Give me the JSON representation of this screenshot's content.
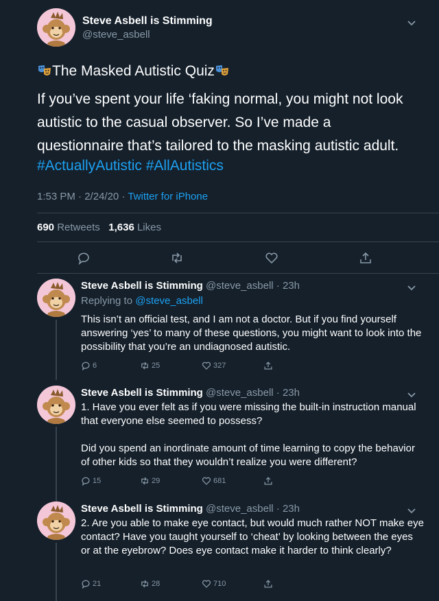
{
  "main_tweet": {
    "author_name": "Steve Asbell is Stimming",
    "author_handle": "@steve_asbell",
    "title": "The Masked Autistic Quiz",
    "body": "If you’ve spent your life ‘faking normal, you might not look autistic to the casual observer. So I’ve made a questionnaire that’s tailored to the masking autistic adult.",
    "hashtags": "#ActuallyAutistic #AllAutistics",
    "time": "1:53 PM",
    "date": "2/24/20",
    "separator": "·",
    "source": "Twitter for iPhone",
    "retweets_count": "690",
    "retweets_label": "Retweets",
    "likes_count": "1,636",
    "likes_label": "Likes"
  },
  "replies": [
    {
      "author_name": "Steve Asbell is Stimming",
      "handle_time": "@steve_asbell · 23h",
      "replying_prefix": "Replying to ",
      "replying_handle": "@steve_asbell",
      "paragraphs": [
        "This isn’t an official test, and I am not a doctor. But if you find yourself answering ‘yes’ to many of these questions, you might want to look into the possibility that you’re an undiagnosed autistic."
      ],
      "replies": "6",
      "retweets": "25",
      "likes": "327"
    },
    {
      "author_name": "Steve Asbell is Stimming",
      "handle_time": "@steve_asbell · 23h",
      "paragraphs": [
        "1. Have you ever felt as if you were missing the built-in instruction manual that everyone else seemed to possess?",
        "Did you spend an inordinate amount of time learning to copy the behavior of other kids so that they wouldn’t realize you were different?"
      ],
      "replies": "15",
      "retweets": "29",
      "likes": "681"
    },
    {
      "author_name": "Steve Asbell is Stimming",
      "handle_time": "@steve_asbell · 23h",
      "paragraphs": [
        "2. Are you able to make eye contact, but would much rather NOT make eye contact? Have you taught yourself to ‘cheat’ by looking between the eyes or at the eyebrow? Does eye contact make it harder to think clearly?"
      ],
      "replies": "21",
      "retweets": "28",
      "likes": "710"
    }
  ],
  "colors": {
    "background": "#15202b",
    "text": "#ffffff",
    "muted": "#8899a6",
    "link": "#1da1f2",
    "divider": "#38444d",
    "avatar_bg": "#f4c7d8"
  },
  "icons": [
    "chevron-down-icon",
    "theater-masks-icon",
    "reply-icon",
    "retweet-icon",
    "like-icon",
    "share-icon"
  ]
}
